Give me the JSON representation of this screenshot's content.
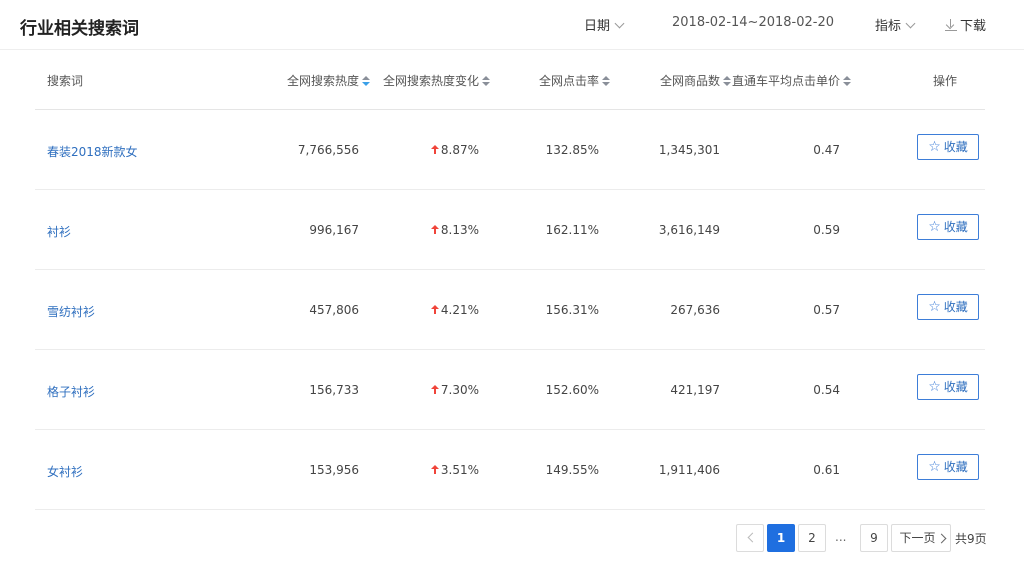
{
  "header": {
    "title": "行业相关搜索词",
    "date_label": "日期",
    "date_range": "2018-02-14~2018-02-20",
    "metric_label": "指标",
    "download_label": "下载"
  },
  "table": {
    "columns": [
      "搜索词",
      "全网搜索热度",
      "全网搜索热度变化",
      "全网点击率",
      "全网商品数",
      "直通车平均点击单价",
      "操作"
    ],
    "rows": [
      {
        "keyword": "春装2018新款女",
        "search_heat": "7,766,556",
        "heat_change": "8.87%",
        "ctr": "132.85%",
        "products": "1,345,301",
        "avg_cpc": "0.47",
        "action": "收藏"
      },
      {
        "keyword": "衬衫",
        "search_heat": "996,167",
        "heat_change": "8.13%",
        "ctr": "162.11%",
        "products": "3,616,149",
        "avg_cpc": "0.59",
        "action": "收藏"
      },
      {
        "keyword": "雪纺衬衫",
        "search_heat": "457,806",
        "heat_change": "4.21%",
        "ctr": "156.31%",
        "products": "267,636",
        "avg_cpc": "0.57",
        "action": "收藏"
      },
      {
        "keyword": "格子衬衫",
        "search_heat": "156,733",
        "heat_change": "7.30%",
        "ctr": "152.60%",
        "products": "421,197",
        "avg_cpc": "0.54",
        "action": "收藏"
      },
      {
        "keyword": "女衬衫",
        "search_heat": "153,956",
        "heat_change": "3.51%",
        "ctr": "149.55%",
        "products": "1,911,406",
        "avg_cpc": "0.61",
        "action": "收藏"
      }
    ],
    "sorted_column": "全网搜索热度",
    "change_direction": "up",
    "change_color": "#f0443a"
  },
  "pagination": {
    "pages": [
      "1",
      "2",
      "9"
    ],
    "ellipsis": "...",
    "current": "1",
    "next_label": "下一页",
    "total_label": "共9页"
  },
  "colors": {
    "accent": "#1f6fe0",
    "link": "#2f6fbf"
  }
}
